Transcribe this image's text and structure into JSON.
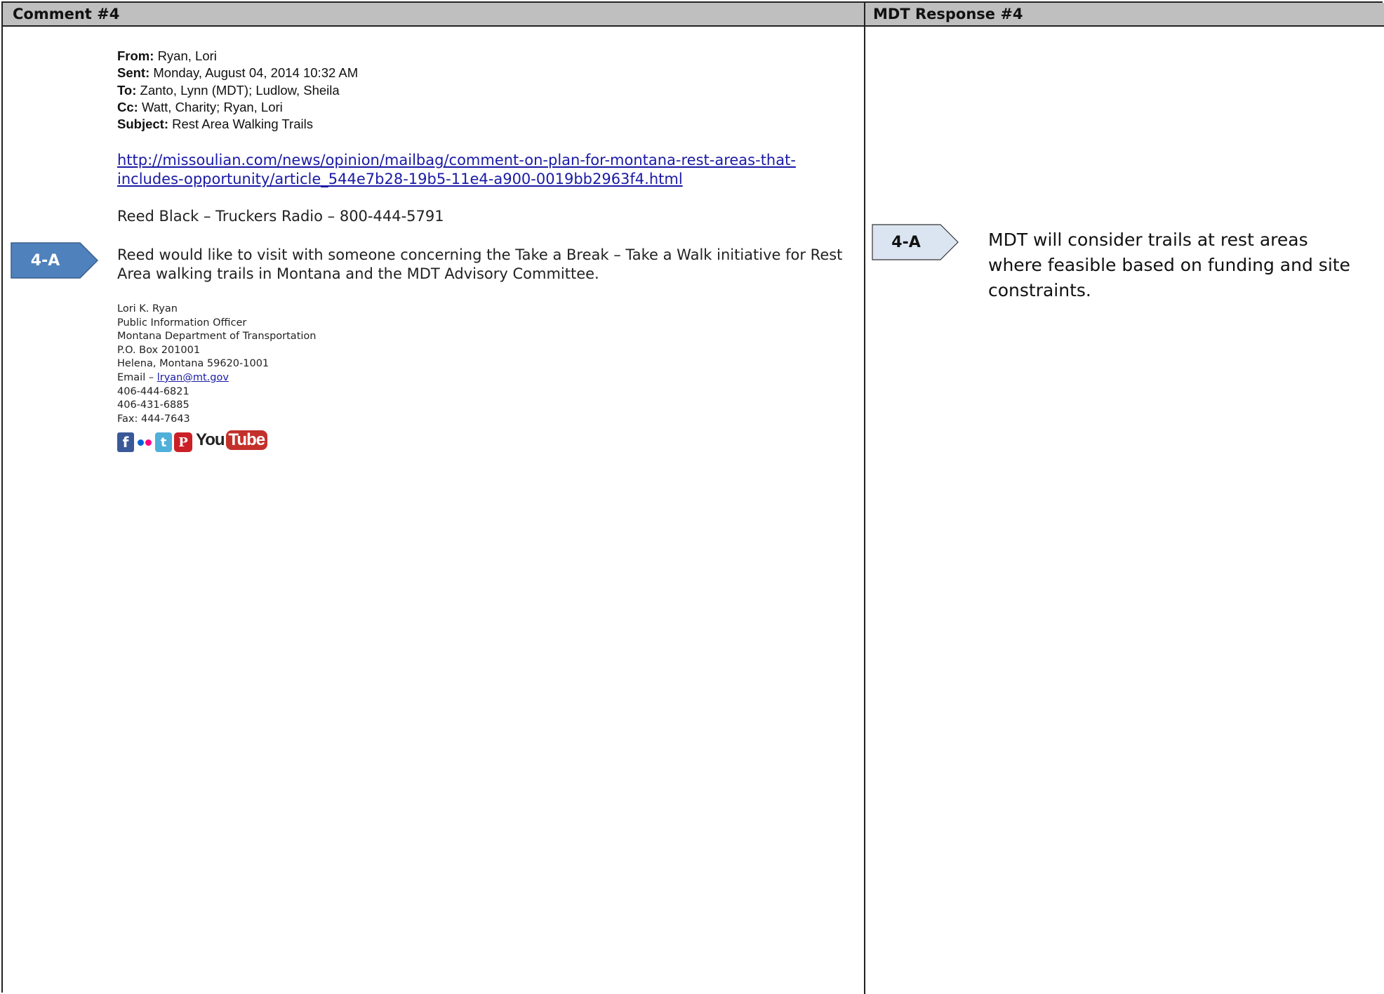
{
  "header": {
    "left_title": "Comment #4",
    "right_title": "MDT Response #4"
  },
  "email": {
    "from_label": "From:",
    "from_value": "Ryan, Lori",
    "sent_label": "Sent:",
    "sent_value": "Monday, August 04, 2014 10:32 AM",
    "to_label": "To:",
    "to_value": "Zanto, Lynn (MDT); Ludlow, Sheila",
    "cc_label": "Cc:",
    "cc_value": "Watt, Charity; Ryan, Lori",
    "subject_label": "Subject:",
    "subject_value": "Rest Area Walking Trails",
    "link_line1": "http://missoulian.com/news/opinion/mailbag/comment-on-plan-for-montana-rest-areas-that-",
    "link_line2": "includes-opportunity/article_544e7b28-19b5-11e4-a900-0019bb2963f4.html",
    "radio_line": "Reed Black – Truckers Radio – 800-444-5791",
    "body_paragraph": "Reed would like to visit with someone concerning the Take a Break – Take a Walk initiative for Rest Area walking trails in Montana and the MDT Advisory Committee."
  },
  "signature": {
    "name": "Lori K. Ryan",
    "title": "Public Information Officer",
    "department": "Montana Department of Transportation",
    "po_box": "P.O. Box 201001",
    "city": "Helena, Montana 59620-1001",
    "email_prefix": "Email – ",
    "email_link": "lryan@mt.gov",
    "phone1": "406-444-6821",
    "phone2": "406-431-6885",
    "fax": "Fax: 444-7643"
  },
  "social_icons": [
    "facebook-icon",
    "flickr-icon",
    "twitter-icon",
    "pinterest-icon",
    "youtube-icon"
  ],
  "social_glyphs": {
    "facebook": "f",
    "twitter": "t",
    "pinterest": "P",
    "youtube_you": "You",
    "youtube_tube": "Tube"
  },
  "tags": {
    "comment_tag": "4-A",
    "response_tag": "4-A"
  },
  "response": {
    "text": "MDT will consider trails at rest areas where feasible based on funding and site constraints."
  },
  "colors": {
    "header_bg": "#bfbfbf",
    "comment_tag_fill": "#4f81bd",
    "response_tag_fill": "#dbe5f1",
    "link": "#1a1aa6"
  }
}
